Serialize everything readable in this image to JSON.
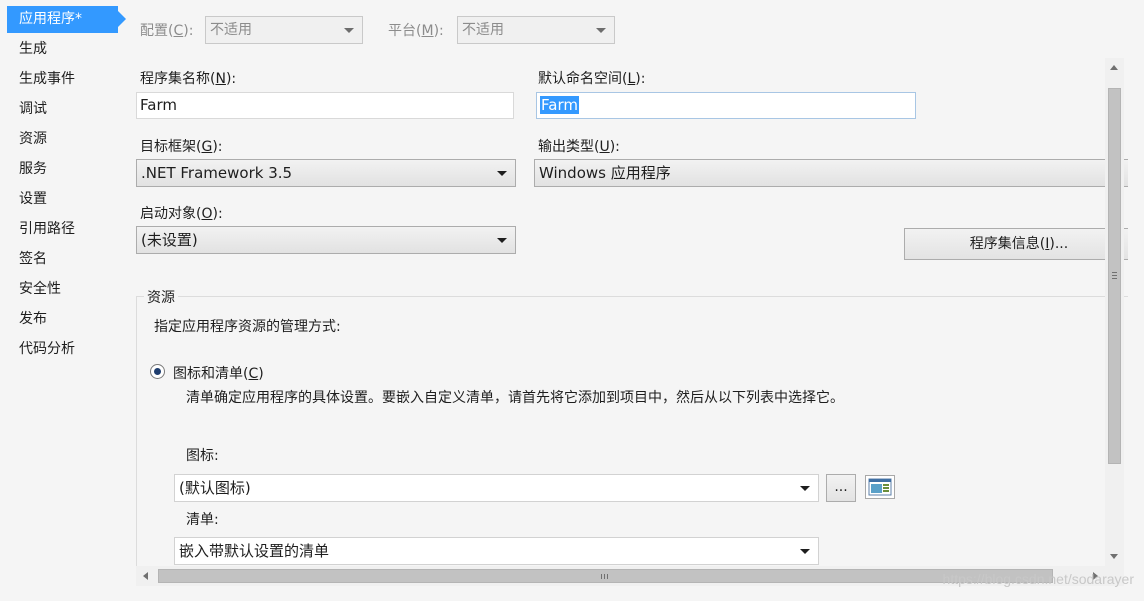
{
  "nav": {
    "items": [
      {
        "label": "应用程序*",
        "active": true
      },
      {
        "label": "生成"
      },
      {
        "label": "生成事件"
      },
      {
        "label": "调试"
      },
      {
        "label": "资源"
      },
      {
        "label": "服务"
      },
      {
        "label": "设置"
      },
      {
        "label": "引用路径"
      },
      {
        "label": "签名"
      },
      {
        "label": "安全性"
      },
      {
        "label": "发布"
      },
      {
        "label": "代码分析"
      }
    ]
  },
  "toolbar": {
    "config_label": "配置(C):",
    "config_label_pre": "配置(",
    "config_label_key": "C",
    "config_label_post": "):",
    "config_value": "不适用",
    "platform_label": "平台(M):",
    "platform_label_pre": "平台(",
    "platform_label_key": "M",
    "platform_label_post": "):",
    "platform_value": "不适用"
  },
  "form": {
    "assembly_name_label_pre": "程序集名称(",
    "assembly_name_label_key": "N",
    "assembly_name_label_post": "):",
    "assembly_name_value": "Farm",
    "namespace_label_pre": "默认命名空间(",
    "namespace_label_key": "L",
    "namespace_label_post": "):",
    "namespace_value": "Farm",
    "framework_label_pre": "目标框架(",
    "framework_label_key": "G",
    "framework_label_post": "):",
    "framework_value": ".NET Framework 3.5",
    "output_type_label_pre": "输出类型(",
    "output_type_label_key": "U",
    "output_type_label_post": "):",
    "output_type_value": "Windows 应用程序",
    "startup_label_pre": "启动对象(",
    "startup_label_key": "O",
    "startup_label_post": "):",
    "startup_value": "(未设置)",
    "assembly_info_button_pre": "程序集信息(",
    "assembly_info_button_key": "I",
    "assembly_info_button_post": ")..."
  },
  "resources": {
    "group_title": "资源",
    "description": "指定应用程序资源的管理方式:",
    "radio_icon_manifest_pre": "图标和清单(",
    "radio_icon_manifest_key": "C",
    "radio_icon_manifest_post": ")",
    "radio_icon_manifest_desc": "清单确定应用程序的具体设置。要嵌入自定义清单，请首先将它添加到项目中，然后从以下列表中选择它。",
    "icon_label": "图标:",
    "icon_value": "(默认图标)",
    "browse_button": "...",
    "manifest_label": "清单:",
    "manifest_value": "嵌入带默认设置的清单"
  },
  "watermark": "https://blog.csdn.net/sodarayer"
}
